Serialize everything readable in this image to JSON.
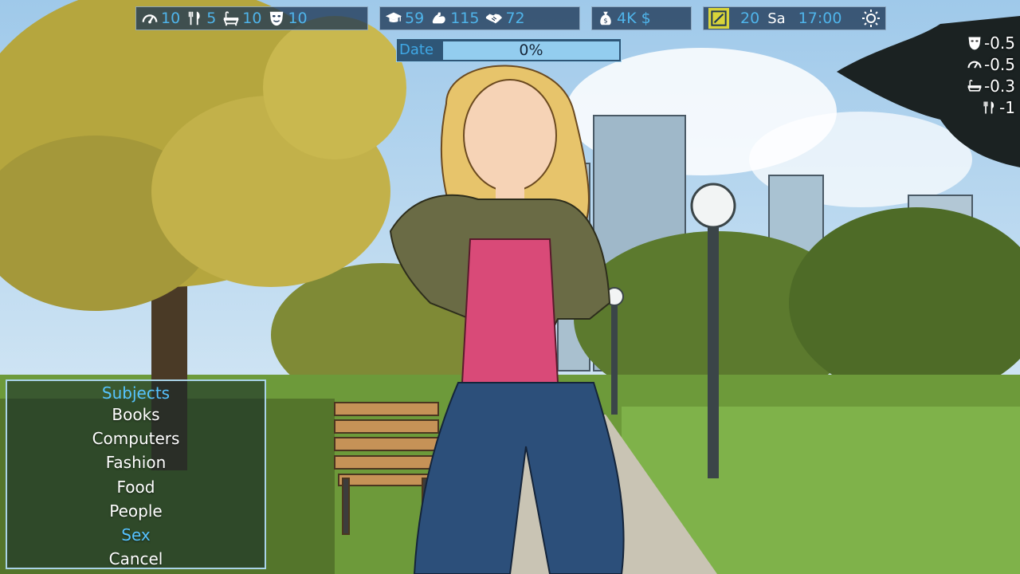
{
  "hud": {
    "needs": [
      {
        "icon": "energy-gauge-icon",
        "value": "10"
      },
      {
        "icon": "fork-knife-icon",
        "value": "5"
      },
      {
        "icon": "bathtub-icon",
        "value": "10"
      },
      {
        "icon": "mask-icon",
        "value": "10"
      }
    ],
    "skills": [
      {
        "icon": "graduation-cap-icon",
        "value": "59"
      },
      {
        "icon": "muscle-icon",
        "value": "115"
      },
      {
        "icon": "handshake-icon",
        "value": "72"
      }
    ],
    "money": {
      "icon": "money-bag-icon",
      "value": "4K $"
    },
    "time": {
      "icon": "notebook-icon",
      "date": "20",
      "day": "Sa",
      "clock": "17:00",
      "weather_icon": "sun-icon"
    }
  },
  "progress": {
    "label": "Date",
    "value_text": "0%",
    "fraction": 0.0
  },
  "effects": [
    {
      "icon": "mask-icon",
      "value": "-0.5"
    },
    {
      "icon": "energy-gauge-icon",
      "value": "-0.5"
    },
    {
      "icon": "bathtub-icon",
      "value": "-0.3"
    },
    {
      "icon": "fork-knife-icon",
      "value": "-1"
    }
  ],
  "menu": {
    "title": "Subjects",
    "items": [
      {
        "label": "Books",
        "selected": false
      },
      {
        "label": "Computers",
        "selected": false
      },
      {
        "label": "Fashion",
        "selected": false
      },
      {
        "label": "Food",
        "selected": false
      },
      {
        "label": "People",
        "selected": false
      },
      {
        "label": "Sex",
        "selected": true
      },
      {
        "label": "Cancel",
        "selected": false
      }
    ]
  },
  "colors": {
    "accent": "#56c3ff",
    "hud_value": "#4fb4ea",
    "panel_border": "#a9d3e7"
  }
}
